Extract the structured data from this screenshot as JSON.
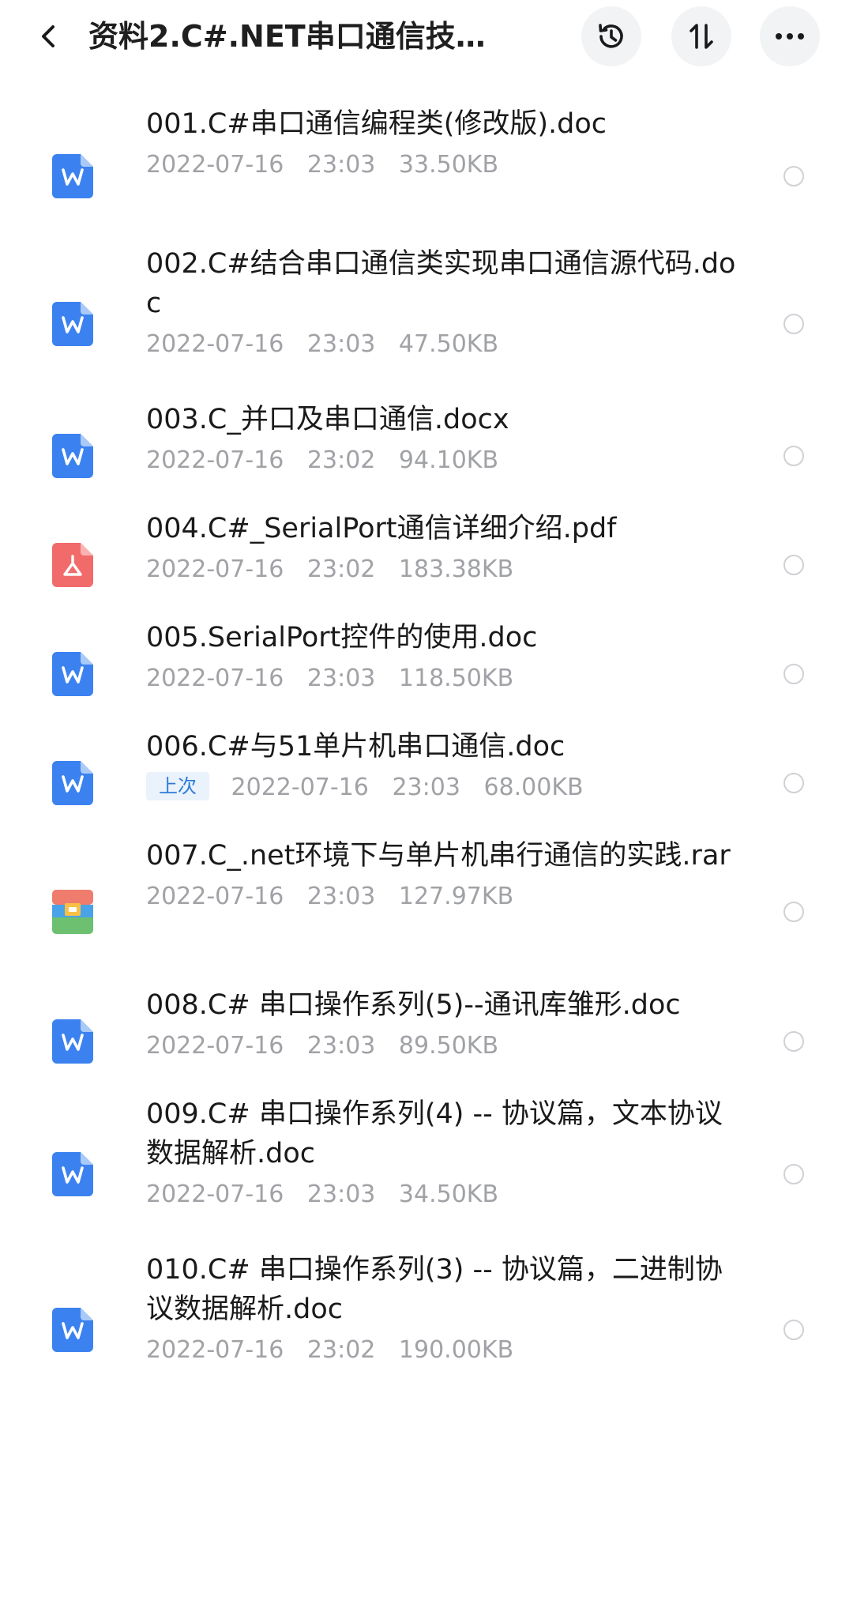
{
  "header": {
    "title": "资料2.C#.NET串口通信技…",
    "back_icon": "chevron-left-icon",
    "history_icon": "history-icon",
    "sort_icon": "sort-icon",
    "more_icon": "more-horizontal-icon"
  },
  "colors": {
    "word": "#3b82f0",
    "pdf": "#f26b6b",
    "badge_bg": "#eaf2fc",
    "badge_text": "#2f7bd8"
  },
  "files": [
    {
      "name": "001.C#串口通信编程类(修改版).doc",
      "date": "2022-07-16",
      "time": "23:03",
      "size": "33.50KB",
      "type": "word",
      "icon": "word-doc-icon",
      "badge": ""
    },
    {
      "name": "002.C#结合串口通信类实现串口通信源代码.doc",
      "date": "2022-07-16",
      "time": "23:03",
      "size": "47.50KB",
      "type": "word",
      "icon": "word-doc-icon",
      "badge": ""
    },
    {
      "name": "003.C_并口及串口通信.docx",
      "date": "2022-07-16",
      "time": "23:02",
      "size": "94.10KB",
      "type": "word",
      "icon": "word-doc-icon",
      "badge": ""
    },
    {
      "name": "004.C#_SerialPort通信详细介绍.pdf",
      "date": "2022-07-16",
      "time": "23:02",
      "size": "183.38KB",
      "type": "pdf",
      "icon": "pdf-icon",
      "badge": ""
    },
    {
      "name": "005.SerialPort控件的使用.doc",
      "date": "2022-07-16",
      "time": "23:03",
      "size": "118.50KB",
      "type": "word",
      "icon": "word-doc-icon",
      "badge": ""
    },
    {
      "name": "006.C#与51单片机串口通信.doc",
      "date": "2022-07-16",
      "time": "23:03",
      "size": "68.00KB",
      "type": "word",
      "icon": "word-doc-icon",
      "badge": "上次"
    },
    {
      "name": "007.C_.net环境下与单片机串行通信的实践.rar",
      "date": "2022-07-16",
      "time": "23:03",
      "size": "127.97KB",
      "type": "rar",
      "icon": "archive-icon",
      "badge": ""
    },
    {
      "name": "008.C# 串口操作系列(5)--通讯库雏形.doc",
      "date": "2022-07-16",
      "time": "23:03",
      "size": "89.50KB",
      "type": "word",
      "icon": "word-doc-icon",
      "badge": ""
    },
    {
      "name": "009.C# 串口操作系列(4) -- 协议篇，文本协议数据解析.doc",
      "date": "2022-07-16",
      "time": "23:03",
      "size": "34.50KB",
      "type": "word",
      "icon": "word-doc-icon",
      "badge": ""
    },
    {
      "name": "010.C# 串口操作系列(3) -- 协议篇，二进制协议数据解析.doc",
      "date": "2022-07-16",
      "time": "23:02",
      "size": "190.00KB",
      "type": "word",
      "icon": "word-doc-icon",
      "badge": ""
    }
  ]
}
